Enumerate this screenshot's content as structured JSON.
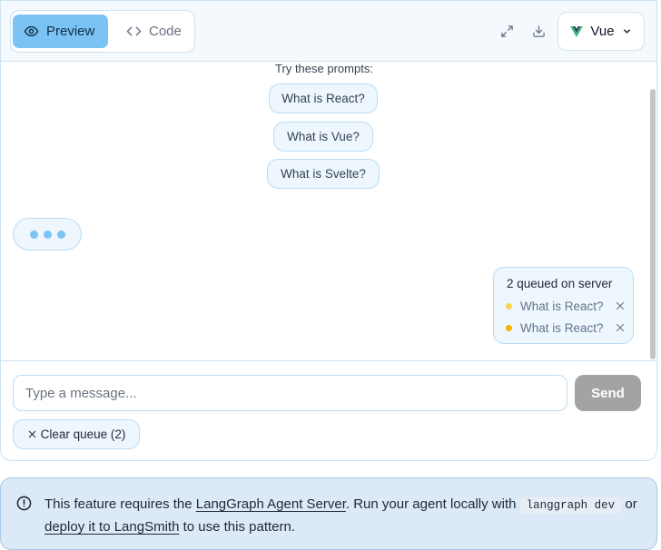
{
  "toolbar": {
    "preview_label": "Preview",
    "code_label": "Code",
    "framework_label": "Vue",
    "icons": [
      "eye-icon",
      "code-icon",
      "expand-icon",
      "download-icon",
      "vue-logo-icon",
      "chevron-down-icon"
    ]
  },
  "prompts": {
    "title": "Try these prompts:",
    "items": [
      "What is React?",
      "What is Vue?",
      "What is Svelte?"
    ]
  },
  "queue": {
    "title": "2 queued on server",
    "items": [
      {
        "label": "What is React?",
        "dot_color": "#fcd34d"
      },
      {
        "label": "What is React?",
        "dot_color": "#f5b400"
      }
    ]
  },
  "composer": {
    "placeholder": "Type a message...",
    "send_label": "Send",
    "clear_label": "Clear queue (2)"
  },
  "notice": {
    "prefix": "This feature requires the ",
    "link1": "LangGraph Agent Server",
    "middle": ". Run your agent locally with ",
    "code": "langgraph dev",
    "or": " or ",
    "link2": "deploy it to LangSmith",
    "suffix": " to use this pattern."
  },
  "colors": {
    "accent": "#7cc3f5",
    "chip_bg": "#eef7fd",
    "notice_bg": "#dce9f6",
    "send_disabled": "#a3a3a3"
  }
}
